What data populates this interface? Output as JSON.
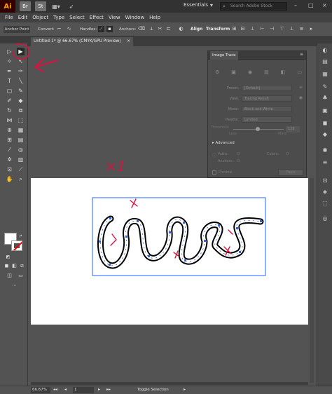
{
  "app": {
    "logo": "Ai",
    "workspace": "Essentials",
    "stock_placeholder": "Search Adobe Stock",
    "bridge_label": "Br",
    "stock_icon_label": "St"
  },
  "menu": [
    "File",
    "Edit",
    "Object",
    "Type",
    "Select",
    "Effect",
    "View",
    "Window",
    "Help"
  ],
  "control_bar": {
    "mode": "Anchor Point",
    "convert": "Convert:",
    "handles": "Handles:",
    "anchors": "Anchors:",
    "align": "Align",
    "transform": "Transform"
  },
  "document_tab": {
    "title": "Untitled-1* @ 66.67% (CMYK/GPU Preview)",
    "close": "×"
  },
  "image_trace": {
    "title": "Image Trace",
    "preset": {
      "label": "Preset:",
      "value": "[Default]"
    },
    "view": {
      "label": "View:",
      "value": "Tracing Result"
    },
    "mode": {
      "label": "Mode:",
      "value": "Black and White"
    },
    "palette": {
      "label": "Palette:",
      "value": "Limited"
    },
    "threshold": {
      "label": "Threshold:",
      "value": "128",
      "less": "Less",
      "more": "More"
    },
    "advanced": "Advanced",
    "paths": {
      "label": "Paths:",
      "value": "0"
    },
    "colors": {
      "label": "Colors:",
      "value": "0"
    },
    "anchors": {
      "label": "Anchors:",
      "value": "0"
    },
    "preview": "Preview",
    "trace_button": "Trace"
  },
  "status": {
    "zoom": "66.67%",
    "page": "1",
    "toggle": "Toggle Selection"
  },
  "annotations": {
    "note": "×1"
  },
  "colors": {
    "accent": "#2266ff",
    "annotation": "#d9123f",
    "canvas": "#ffffff",
    "ui_bg": "#535353"
  }
}
